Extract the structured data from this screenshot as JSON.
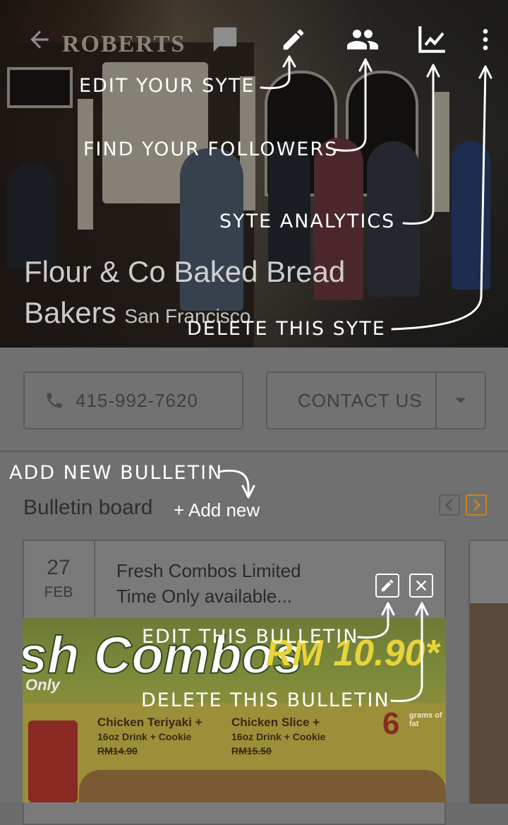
{
  "header": {
    "store_sign": "ROBERTS",
    "title": "Flour & Co Baked Bread Bakers",
    "title_line1": "Flour & Co Baked Bread",
    "title_line2": "Bakers",
    "city": "San Francisco",
    "icons": [
      "back-arrow-icon",
      "chat-icon",
      "edit-pencil-icon",
      "followers-icon",
      "analytics-chart-icon",
      "more-vert-icon"
    ]
  },
  "actions": {
    "phone": "415-992-7620",
    "contact_label": "CONTACT US"
  },
  "bulletin": {
    "heading": "Bulletin board",
    "add_label": "+ Add new",
    "card": {
      "day": "27",
      "month": "FEB",
      "title_line1": "Fresh Combos Limited",
      "title_line2": "Time Only available..."
    },
    "promo": {
      "headline": "sh Combos",
      "sub": "Only",
      "price": "RM 10.90*",
      "item1": "Chicken Teriyaki +",
      "item1_sub": "16oz Drink + Cookie",
      "item1_old": "RM14.90",
      "item2": "Chicken Slice +",
      "item2_sub": "16oz Drink + Cookie",
      "item2_old": "RM15.50",
      "fat": "6",
      "fat_label": "grams of fat"
    }
  },
  "annotations": {
    "edit_syte": "EDIT YOUR SYTE",
    "find_followers": "FIND YOUR FOLLOWERS",
    "analytics": "SYTE ANALYTICS",
    "delete_syte": "DELETE THIS SYTE",
    "add_bulletin": "ADD NEW BULLETIN",
    "edit_bulletin": "EDIT THIS BULLETIN",
    "delete_bulletin": "DELETE THIS BULLETIN"
  }
}
